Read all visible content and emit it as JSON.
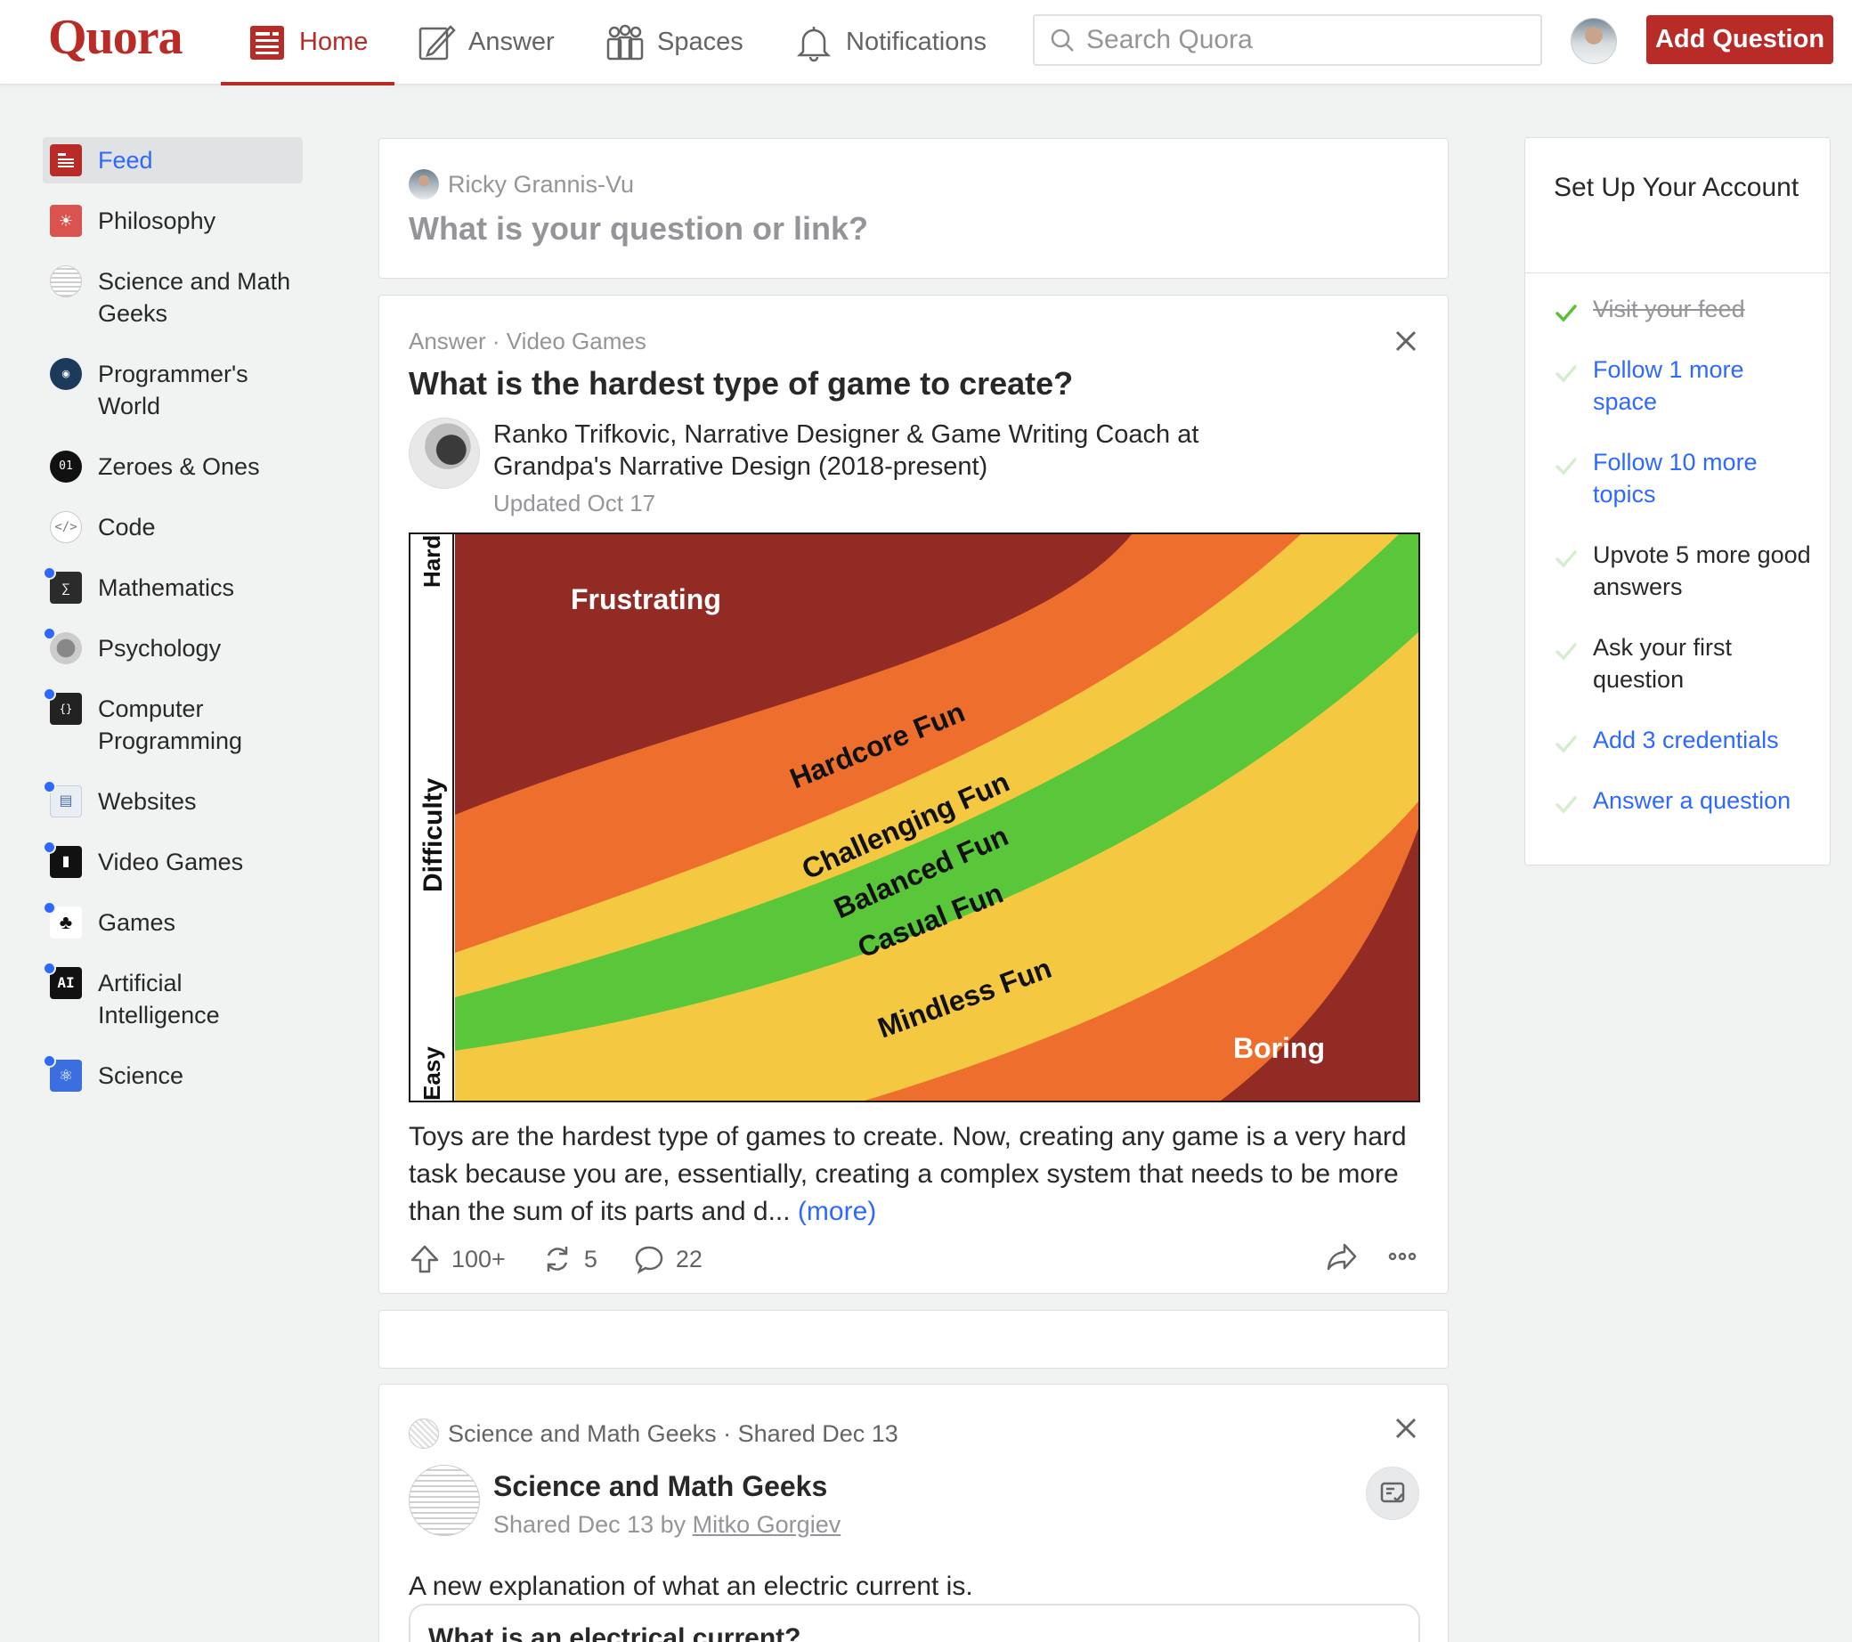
{
  "app": {
    "logo": "Quora"
  },
  "nav": {
    "home": "Home",
    "answer": "Answer",
    "spaces": "Spaces",
    "notifications": "Notifications",
    "search_placeholder": "Search Quora",
    "add_question": "Add Question"
  },
  "sidebar": {
    "items": [
      {
        "label": "Feed",
        "icon": "feed-icon"
      },
      {
        "label": "Philosophy",
        "icon": "philosophy-icon"
      },
      {
        "label": "Science and Math Geeks",
        "icon": "science-math-icon"
      },
      {
        "label": "Programmer's World",
        "icon": "programmers-world-icon"
      },
      {
        "label": "Zeroes & Ones",
        "icon": "zeroes-ones-icon"
      },
      {
        "label": "Code",
        "icon": "code-icon"
      },
      {
        "label": "Mathematics",
        "icon": "mathematics-icon"
      },
      {
        "label": "Psychology",
        "icon": "psychology-icon"
      },
      {
        "label": "Computer Programming",
        "icon": "computer-programming-icon"
      },
      {
        "label": "Websites",
        "icon": "websites-icon"
      },
      {
        "label": "Video Games",
        "icon": "video-games-icon"
      },
      {
        "label": "Games",
        "icon": "games-icon"
      },
      {
        "label": "Artificial Intelligence",
        "icon": "ai-icon"
      },
      {
        "label": "Science",
        "icon": "science-icon"
      }
    ]
  },
  "ask": {
    "user": "Ricky Grannis-Vu",
    "prompt": "What is your question or link?"
  },
  "answer_card": {
    "meta": "Answer · Video Games",
    "question": "What is the hardest type of game to create?",
    "author": "Ranko Trifkovic, Narrative Designer & Game Writing Coach at Grandpa's Narrative Design (2018-present)",
    "updated": "Updated Oct 17",
    "body": "Toys are the hardest type of games to create. Now, creating any game is a very hard task because you are, essentially, creating a complex system that needs to be more than the sum of its parts and d...",
    "more": "(more)",
    "upvotes": "100+",
    "shares": "5",
    "comments": "22",
    "image": {
      "y_axis_label": "Difficulty",
      "y_top": "Hard",
      "y_bottom": "Easy",
      "bands": [
        {
          "label": "Frustrating",
          "color": "#922b24"
        },
        {
          "label": "Hardcore Fun",
          "color": "#ee6f2d"
        },
        {
          "label": "Challenging Fun",
          "color": "#f5c842"
        },
        {
          "label": "Balanced Fun",
          "color": "#5ac73a"
        },
        {
          "label": "Casual Fun",
          "color": "#f5c842"
        },
        {
          "label": "Mindless Fun",
          "color": "#ee6f2d"
        },
        {
          "label": "Boring",
          "color": "#922b24"
        }
      ]
    }
  },
  "shared_card": {
    "meta": "Science and Math Geeks · Shared Dec 13",
    "title": "Science and Math Geeks",
    "sub_prefix": "Shared Dec 13 by",
    "sub_author": "Mitko Gorgiev",
    "text": "A new explanation of what an electric current is.",
    "inner_title": "What is an electrical current?"
  },
  "setup": {
    "title": "Set Up Your Account",
    "items": [
      {
        "label": "Visit your feed",
        "state": "done"
      },
      {
        "label": "Follow 1 more space",
        "state": "link"
      },
      {
        "label": "Follow 10 more topics",
        "state": "link"
      },
      {
        "label": "Upvote 5 more good answers",
        "state": "plain"
      },
      {
        "label": "Ask your first question",
        "state": "plain"
      },
      {
        "label": "Add 3 credentials",
        "state": "link"
      },
      {
        "label": "Answer a question",
        "state": "link"
      }
    ]
  },
  "colors": {
    "brand": "#b92b27",
    "link": "#2e69ff",
    "check_done": "#5bc236",
    "check_pending": "#d8ecd0"
  }
}
